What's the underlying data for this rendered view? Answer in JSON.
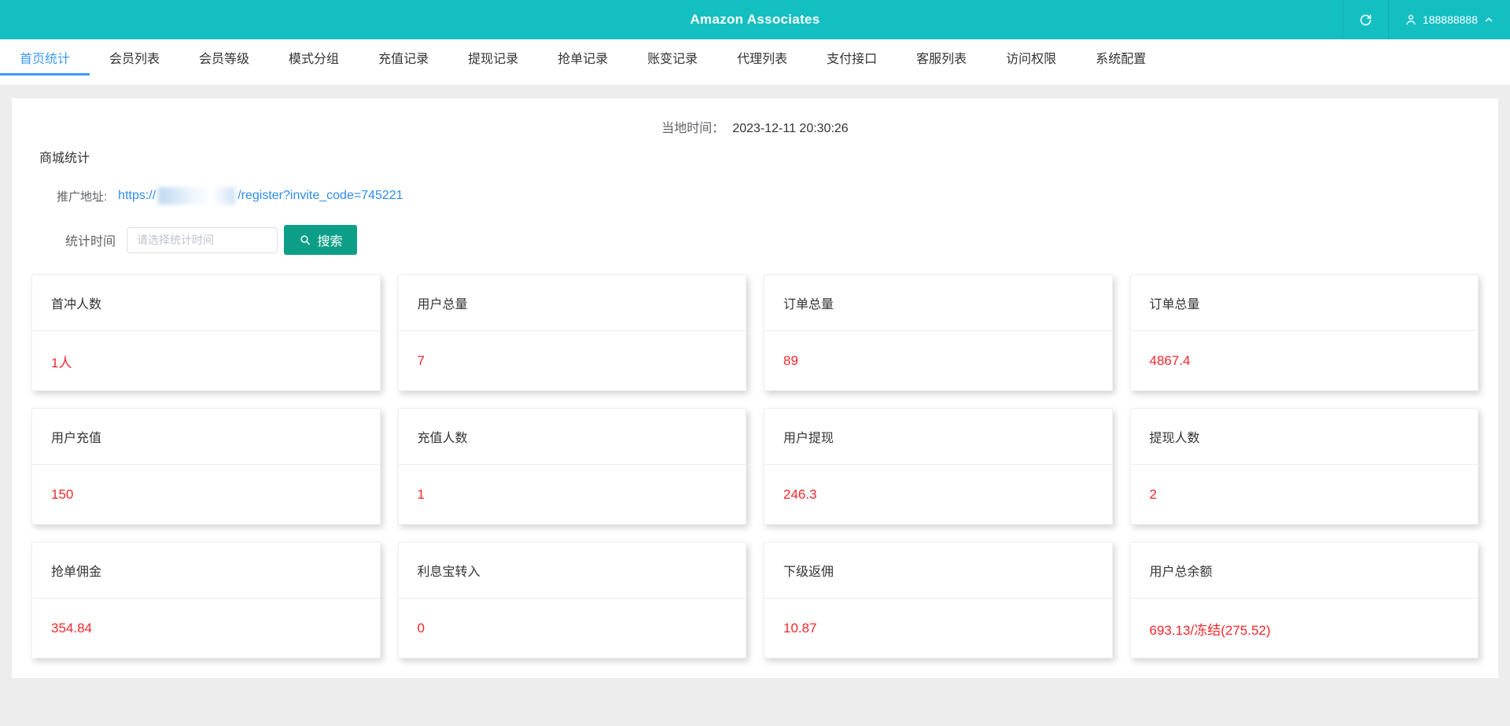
{
  "header": {
    "title": "Amazon Associates",
    "account": "188888888",
    "icons": {
      "refresh": "refresh-icon",
      "user": "user-icon",
      "chevron": "chevron-up-icon"
    }
  },
  "nav": {
    "active_index": 0,
    "tabs": [
      "首页统计",
      "会员列表",
      "会员等级",
      "模式分组",
      "充值记录",
      "提现记录",
      "抢单记录",
      "账变记录",
      "代理列表",
      "支付接口",
      "客服列表",
      "访问权限",
      "系统配置"
    ]
  },
  "main": {
    "local_time_label": "当地时间：",
    "local_time_value": "2023-12-11 20:30:26",
    "section_title": "商城统计",
    "promo": {
      "label": "推广地址:",
      "url_prefix": "https://",
      "url_masked": true,
      "url_suffix": "/register?invite_code=745221"
    },
    "stat_time": {
      "label": "统计时间",
      "placeholder": "请选择统计时间",
      "search_label": "搜索"
    }
  },
  "cards": [
    {
      "title": "首冲人数",
      "value": "1人"
    },
    {
      "title": "用户总量",
      "value": "7"
    },
    {
      "title": "订单总量",
      "value": "89"
    },
    {
      "title": "订单总量",
      "value": "4867.4"
    },
    {
      "title": "用户充值",
      "value": "150"
    },
    {
      "title": "充值人数",
      "value": "1"
    },
    {
      "title": "用户提现",
      "value": "246.3"
    },
    {
      "title": "提现人数",
      "value": "2"
    },
    {
      "title": "抢单佣金",
      "value": "354.84"
    },
    {
      "title": "利息宝转入",
      "value": "0"
    },
    {
      "title": "下级返佣",
      "value": "10.87"
    },
    {
      "title": "用户总余额",
      "value": "693.13/冻结(275.52)"
    }
  ],
  "colors": {
    "header_teal": "#14bfc2",
    "tab_active_blue": "#3d9af5",
    "link_blue": "#2d8cf0",
    "search_button_green": "#0c9e87",
    "value_red": "#f5262b"
  }
}
